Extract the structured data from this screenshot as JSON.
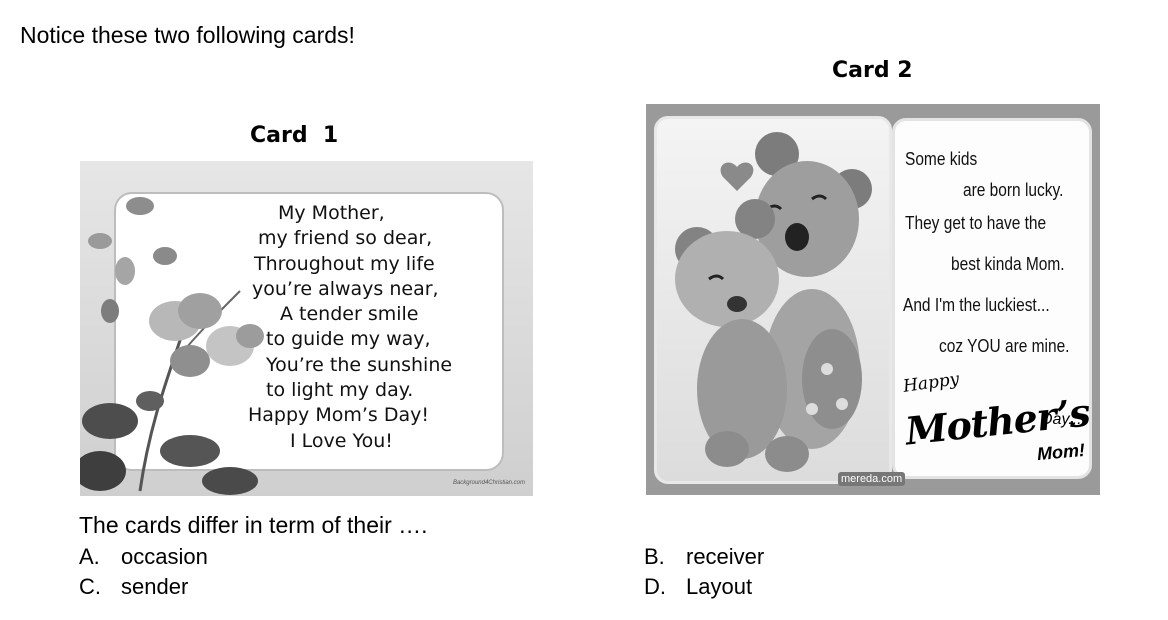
{
  "instruction": "Notice these two following cards!",
  "card1": {
    "title": "Card  1",
    "poem": [
      "My Mother,",
      "my friend so dear,",
      "Throughout my life",
      "you’re always near,",
      "A tender smile",
      "to guide my way,",
      "You’re the sunshine",
      "to light my day.",
      "Happy Mom’s Day!",
      "I Love You!"
    ],
    "credit": "Background4Christian.com"
  },
  "card2": {
    "title": "Card 2",
    "lines": [
      "Some kids",
      "are born lucky.",
      "They get to have the",
      "best kinda Mom.",
      "And I'm the luckiest...",
      "coz YOU are mine."
    ],
    "happy": "Happy",
    "mothers": "Mother’s",
    "day": "Day...",
    "mom": "Mom!",
    "credit": "mereda.com"
  },
  "question": {
    "stem": "The cards differ in term of their ….",
    "options": [
      {
        "letter": "A.",
        "text": "occasion"
      },
      {
        "letter": "B.",
        "text": "receiver"
      },
      {
        "letter": "C.",
        "text": "sender"
      },
      {
        "letter": "D.",
        "text": "Layout"
      }
    ]
  }
}
